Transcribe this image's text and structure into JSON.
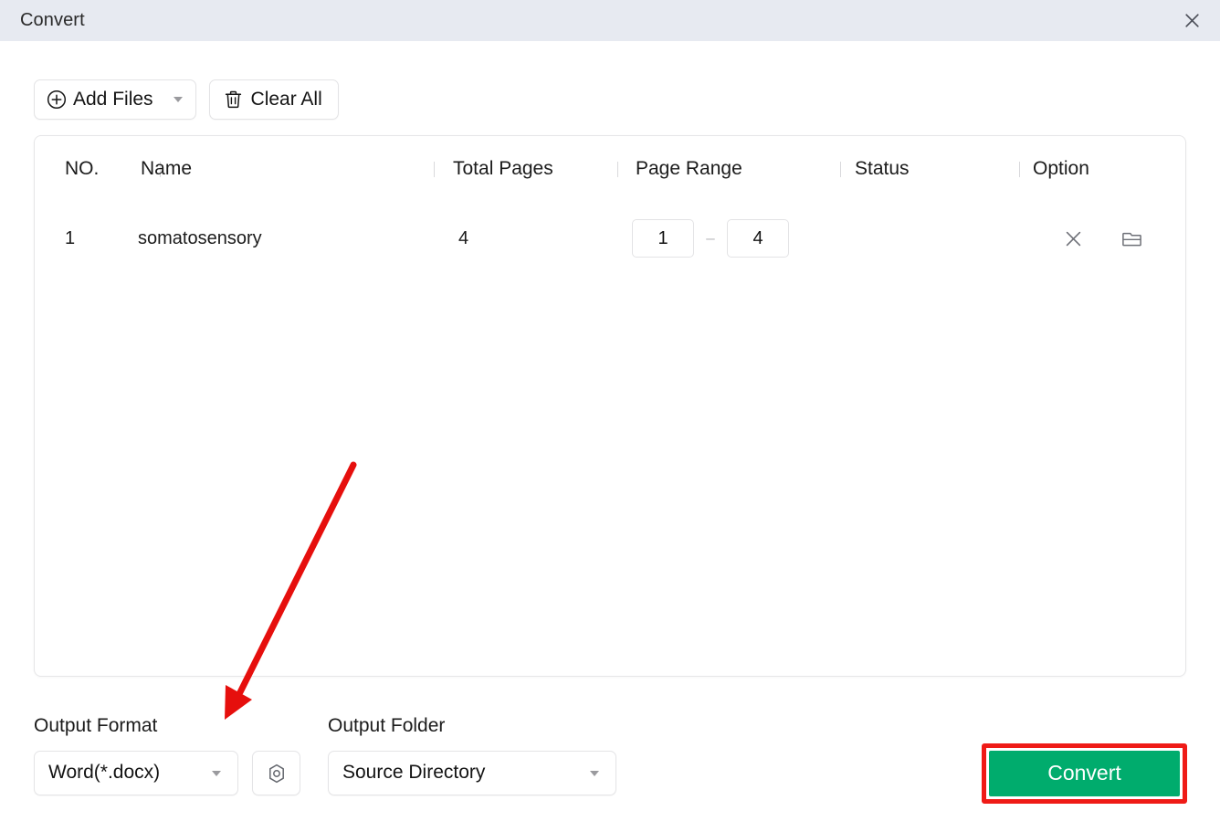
{
  "window": {
    "title": "Convert",
    "close_icon": "close-icon"
  },
  "toolbar": {
    "add_files_label": "Add Files",
    "add_files_icon": "plus-circle-icon",
    "add_files_caret_icon": "chevron-down-icon",
    "clear_all_label": "Clear All",
    "clear_all_icon": "trash-icon"
  },
  "table": {
    "columns": [
      {
        "key": "no",
        "label": "NO."
      },
      {
        "key": "name",
        "label": "Name"
      },
      {
        "key": "total_pages",
        "label": "Total Pages"
      },
      {
        "key": "page_range",
        "label": "Page Range"
      },
      {
        "key": "status",
        "label": "Status"
      },
      {
        "key": "option",
        "label": "Option"
      }
    ],
    "rows": [
      {
        "no": "1",
        "name": "somatosensory",
        "total_pages": "4",
        "page_range_from": "1",
        "page_range_dash": "–",
        "page_range_to": "4",
        "status": "",
        "remove_icon": "close-icon",
        "folder_icon": "folder-icon"
      }
    ]
  },
  "output": {
    "format_label": "Output Format",
    "format_value": "Word(*.docx)",
    "format_caret_icon": "chevron-down-icon",
    "settings_icon": "hex-nut-settings-icon",
    "folder_label": "Output Folder",
    "folder_value": "Source Directory",
    "folder_caret_icon": "chevron-down-icon"
  },
  "actions": {
    "convert_label": "Convert"
  },
  "annotation": {
    "arrow_color": "#e60f0d",
    "highlight_color": "#ef1b17"
  },
  "colors": {
    "titlebar_bg": "#e7eaf1",
    "convert_green": "#00ac6d",
    "page_bg": "#ffffff",
    "border": "#e4e4e6"
  }
}
